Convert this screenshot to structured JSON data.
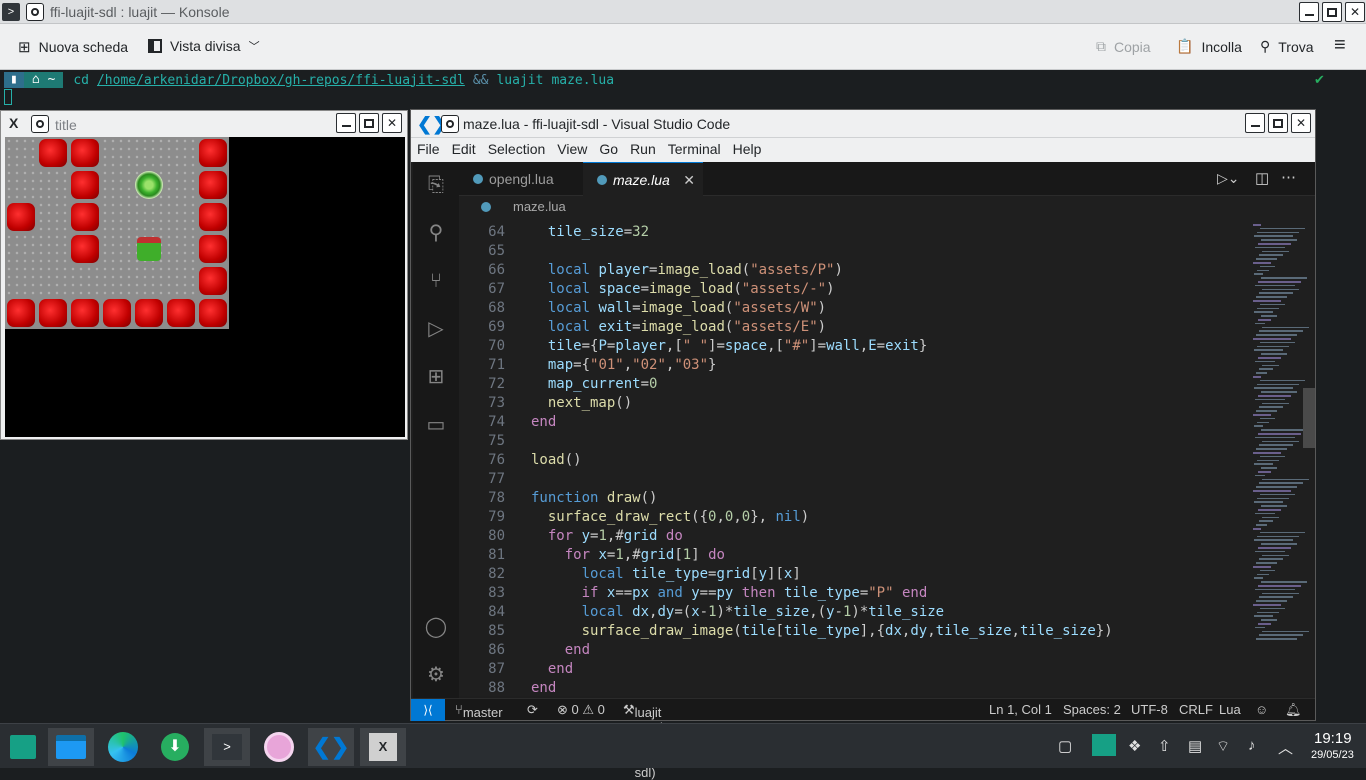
{
  "konsole": {
    "title": "ffi-luajit-sdl : luajit — Konsole",
    "toolbar": {
      "new_tab": "Nuova scheda",
      "split_view": "Vista divisa",
      "copy": "Copia",
      "paste": "Incolla",
      "find": "Trova"
    },
    "prompt": {
      "seg_home": "~",
      "cmd_cd": "cd",
      "path": "/home/arkenidar/Dropbox/gh-repos/ffi-luajit-sdl",
      "op": "&&",
      "cmd_luajit": "luajit",
      "arg": "maze.lua",
      "check": "✔"
    }
  },
  "sdl_window": {
    "title": "title"
  },
  "vscode": {
    "title": "maze.lua - ffi-luajit-sdl - Visual Studio Code",
    "menu": [
      "File",
      "Edit",
      "Selection",
      "View",
      "Go",
      "Run",
      "Terminal",
      "Help"
    ],
    "tabs": [
      "opengl.lua",
      "maze.lua"
    ],
    "breadcrumb": "maze.lua",
    "status": {
      "branch": "master",
      "problems": "⊗ 0 ⚠ 0",
      "task": "luajit app.lua (ffi-luajit-sdl)",
      "position": "Ln 1, Col 1",
      "spaces": "Spaces: 2",
      "encoding": "UTF-8",
      "eol": "CRLF",
      "language": "Lua"
    },
    "line_numbers": [
      "",
      "65",
      "66",
      "67",
      "68",
      "69",
      "70",
      "71",
      "72",
      "73",
      "74",
      "75",
      "76",
      "77",
      "78",
      "79",
      "80",
      "81",
      "82",
      "83",
      "84",
      "85",
      "86",
      "87",
      "88"
    ],
    "first_line_number": "64"
  },
  "taskbar": {
    "time": "19:19",
    "date": "29/05/23"
  },
  "colors": {
    "vscode_accent": "#0078d4",
    "terminal_bg": "#1b1e20",
    "wall_red": "#e00000"
  }
}
